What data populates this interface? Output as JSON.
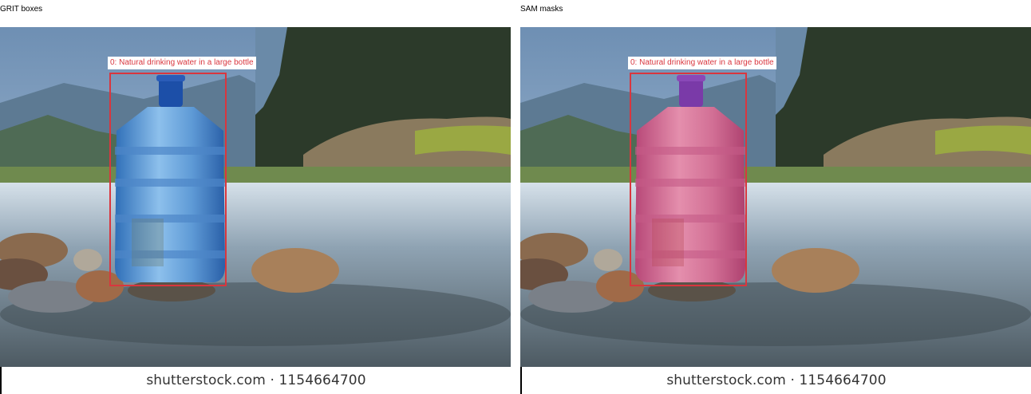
{
  "panels": [
    {
      "title": "GRIT boxes",
      "mask": false
    },
    {
      "title": "SAM masks",
      "mask": true
    }
  ],
  "detection": {
    "label": "0: Natural drinking water in a large bottle",
    "box_color": "#d9363e",
    "mask_color": "#e0407a"
  },
  "image": {
    "watermark": "shutterstock.com · 1154664700"
  }
}
